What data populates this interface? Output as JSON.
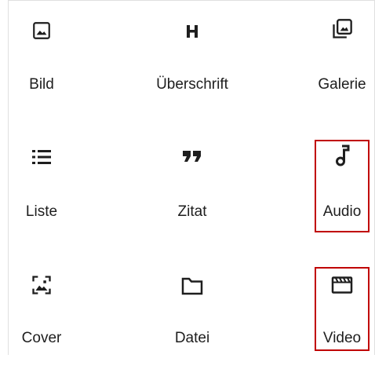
{
  "blocks": [
    {
      "label": "Bild",
      "icon": "image-icon"
    },
    {
      "label": "Überschrift",
      "icon": "heading-icon"
    },
    {
      "label": "Galerie",
      "icon": "gallery-icon"
    },
    {
      "label": "Liste",
      "icon": "list-icon"
    },
    {
      "label": "Zitat",
      "icon": "quote-icon"
    },
    {
      "label": "Audio",
      "icon": "audio-icon"
    },
    {
      "label": "Cover",
      "icon": "cover-icon"
    },
    {
      "label": "Datei",
      "icon": "file-icon"
    },
    {
      "label": "Video",
      "icon": "video-icon"
    }
  ],
  "highlighted_blocks": [
    "Audio",
    "Video"
  ],
  "colors": {
    "text": "#1e1e1e",
    "icon": "#1e1e1e",
    "highlight": "#c00000",
    "border": "#e0e0e0"
  }
}
